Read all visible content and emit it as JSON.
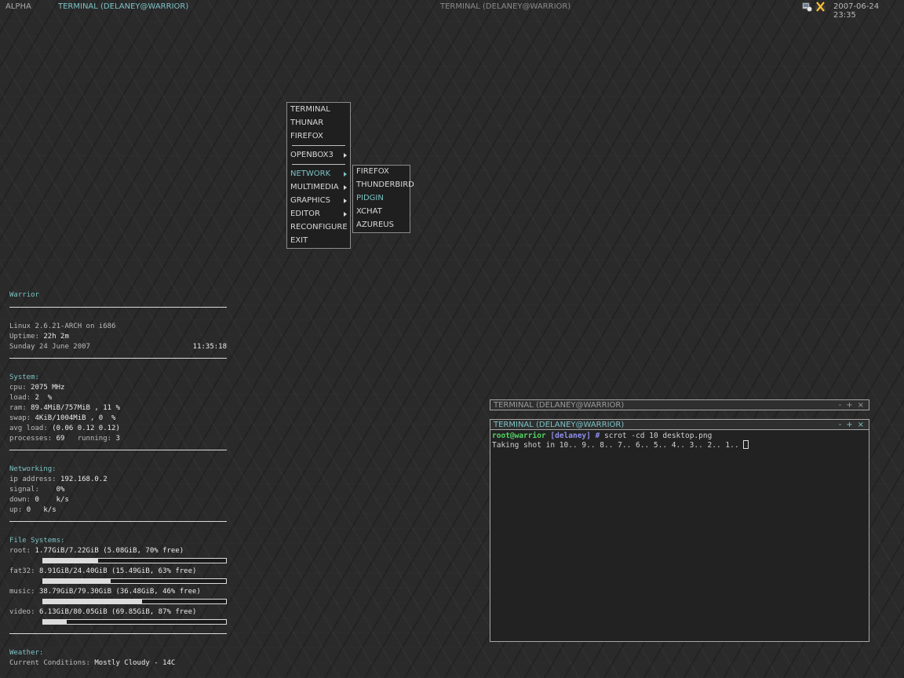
{
  "topbar": {
    "desktop_name": "ALPHA",
    "active_task": "TERMINAL (DELANEY@WARRIOR)",
    "center_title": "TERMINAL (DELANEY@WARRIOR)",
    "clock": "2007-06-24 23:35",
    "tray_icons": [
      "network-status-icon",
      "close-x-icon"
    ]
  },
  "menu": {
    "items": [
      {
        "label": "TERMINAL"
      },
      {
        "label": "THUNAR"
      },
      {
        "label": "FIREFOX"
      },
      {
        "label": "OPENBOX3",
        "submenu": true
      },
      {
        "label": "NETWORK",
        "submenu": true,
        "highlighted": true
      },
      {
        "label": "MULTIMEDIA",
        "submenu": true
      },
      {
        "label": "GRAPHICS",
        "submenu": true
      },
      {
        "label": "EDITOR",
        "submenu": true
      },
      {
        "label": "RECONFIGURE"
      },
      {
        "label": "EXIT"
      }
    ],
    "network_submenu": [
      {
        "label": "FIREFOX"
      },
      {
        "label": "THUNDERBIRD"
      },
      {
        "label": "PIDGIN",
        "highlighted": true
      },
      {
        "label": "XCHAT"
      },
      {
        "label": "AZUREUS"
      }
    ]
  },
  "conky": {
    "hostname": "Warrior",
    "kernel": "Linux 2.6.21-ARCH on i686",
    "uptime_label": "Uptime:",
    "uptime": "22h 2m",
    "date": "Sunday 24 June 2007",
    "time": "11:35:18",
    "system_head": "System:",
    "cpu_label": "cpu:",
    "cpu": "2075 MHz",
    "load_label": "load:",
    "load": "2  %",
    "ram_label": "ram:",
    "ram": "89.4MiB/757MiB , 11 %",
    "swap_label": "swap:",
    "swap": "4KiB/1004MiB , 0  %",
    "avgload_label": "avg load:",
    "avgload": "(0.06 0.12 0.12)",
    "processes_label": "processes:",
    "processes": "69",
    "running_label": "running:",
    "running": "3",
    "net_head": "Networking:",
    "ip_label": "ip address:",
    "ip": "192.168.0.2",
    "signal_label": "signal:",
    "signal": "0%",
    "down_label": "down:",
    "down": "0    k/s",
    "up_label": "up:",
    "up": "0   k/s",
    "fs_head": "File Systems:",
    "filesystems": [
      {
        "label": "root:",
        "value": "1.77GiB/7.22GiB (5.08GiB, 70% free)",
        "used_fraction": 0.3
      },
      {
        "label": "fat32:",
        "value": "8.91GiB/24.40GiB (15.49GiB, 63% free)",
        "used_fraction": 0.37
      },
      {
        "label": "music:",
        "value": "38.79GiB/79.30GiB (36.48GiB, 46% free)",
        "used_fraction": 0.54
      },
      {
        "label": "video:",
        "value": "6.13GiB/80.05GiB (69.85GiB, 87% free)",
        "used_fraction": 0.13
      }
    ],
    "weather_head": "Weather:",
    "conditions_label": "Current Conditions:",
    "conditions": "Mostly Cloudy - 14C"
  },
  "terminals": {
    "back_title": "TERMINAL (DELANEY@WARRIOR)",
    "front_title": "TERMINAL (DELANEY@WARRIOR)",
    "buttons": [
      "-",
      "+",
      "×"
    ],
    "prompt_user": "root@warrior",
    "prompt_dir": "[delaney] #",
    "command": "scrot -cd 10 desktop.png",
    "output": "Taking shot in 10.. 9.. 8.. 7.. 6.. 5.. 4.. 3.. 2.. 1.. "
  },
  "colors": {
    "accent": "#7cc2c4",
    "prompt_user": "#54d463",
    "prompt_dir": "#8f8ff0"
  }
}
